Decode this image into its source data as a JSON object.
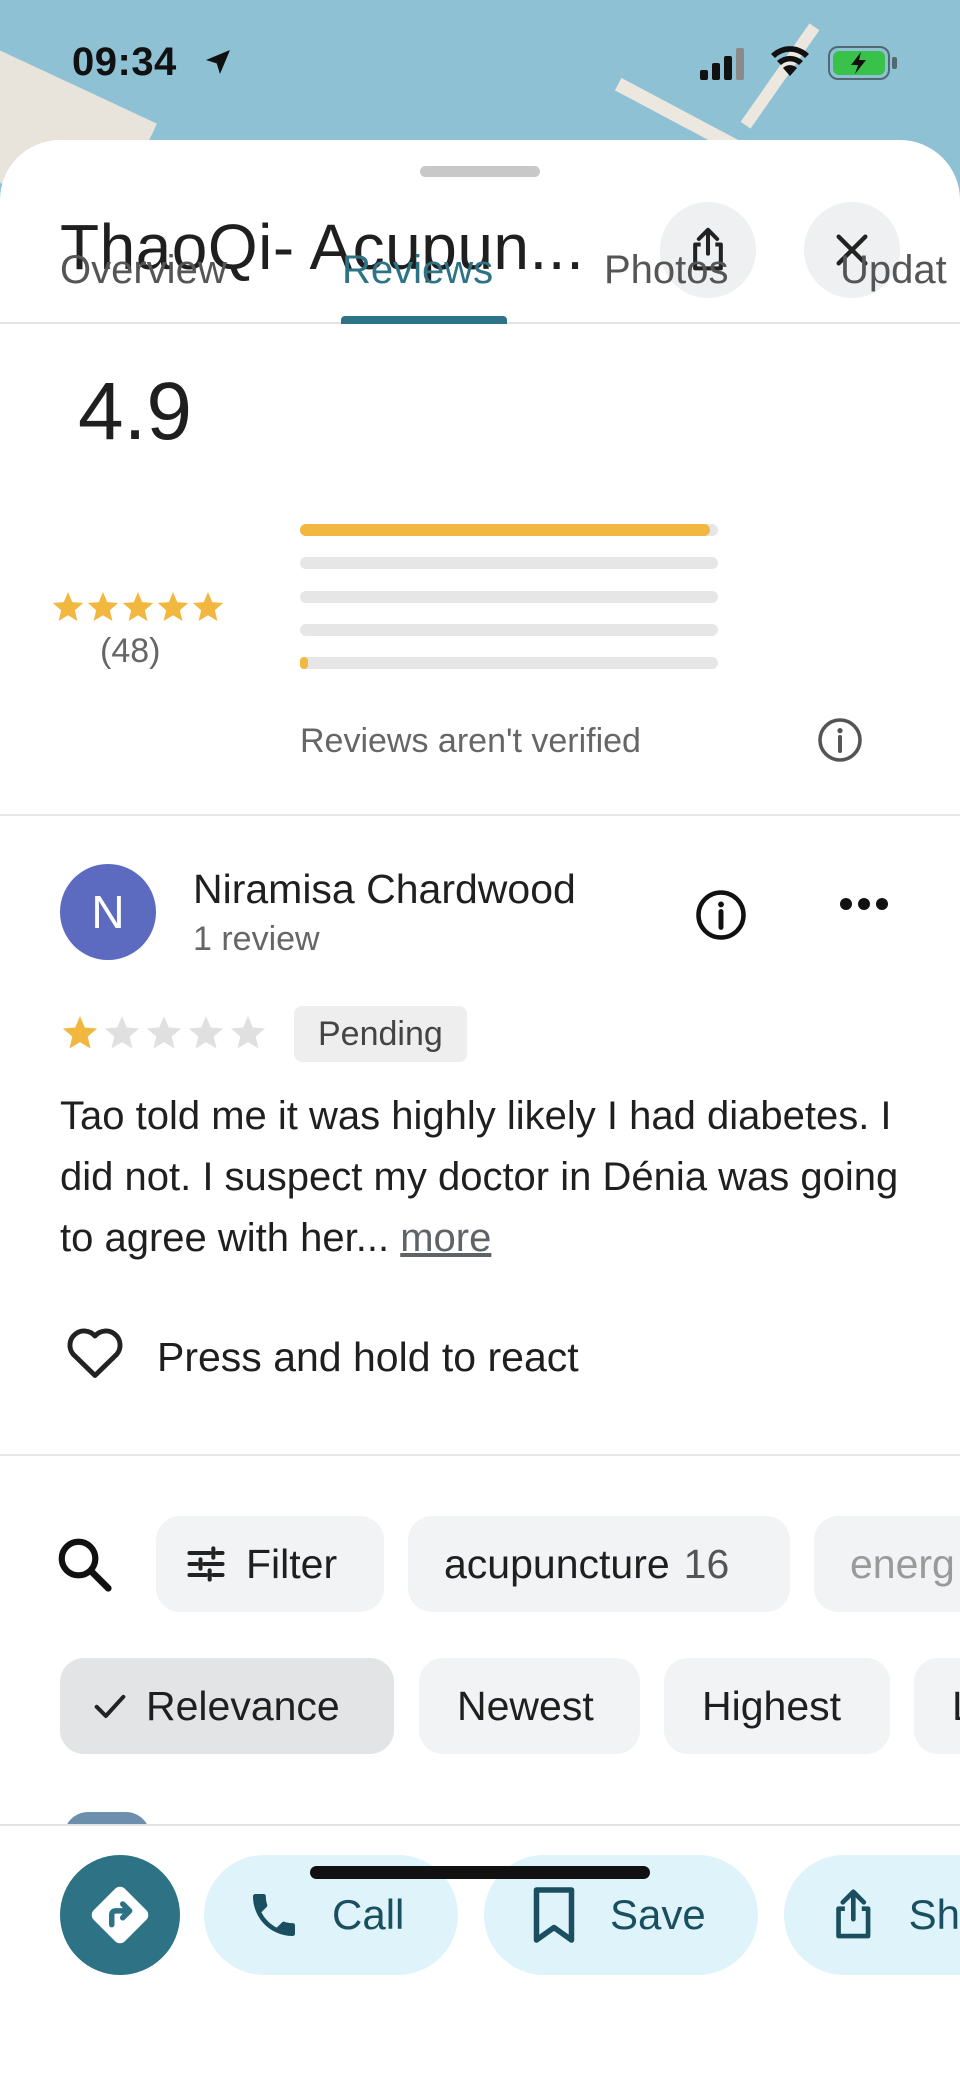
{
  "status": {
    "time": "09:34"
  },
  "place": {
    "title": "ThaoQi- Acupun..."
  },
  "tabs": [
    {
      "label": "Overview",
      "active": false
    },
    {
      "label": "Reviews",
      "active": true
    },
    {
      "label": "Photos",
      "active": false
    },
    {
      "label": "Updat",
      "active": false
    }
  ],
  "rating_summary": {
    "rating": "4.9",
    "count": "(48)",
    "stars": 4.9,
    "distribution_fraction": [
      0.98,
      0,
      0,
      0,
      0.02
    ],
    "unverified_notice": "Reviews aren't verified"
  },
  "review": {
    "avatar_letter": "N",
    "avatar_color": "#5c6bc0",
    "name": "Niramisa Chardwood",
    "meta": "1 review",
    "stars": 1,
    "status": "Pending",
    "text": "Tao told me it was highly likely I had diabetes. I did not. I suspect my doctor in Dénia was going to agree with her... ",
    "more_label": "more",
    "react_label": "Press and hold to react"
  },
  "filters": {
    "filter_label": "Filter",
    "topic_label": "acupuncture",
    "topic_count": "16",
    "next_topic_partial": "energ"
  },
  "sort": {
    "options": [
      "Relevance",
      "Newest",
      "Highest",
      "L"
    ],
    "selected": "Relevance"
  },
  "actions": {
    "call_label": "Call",
    "save_label": "Save",
    "share_label": "Sh"
  },
  "colors": {
    "accent": "#2d7385",
    "star": "#f2b73f",
    "action_bg": "#dff3fb"
  }
}
